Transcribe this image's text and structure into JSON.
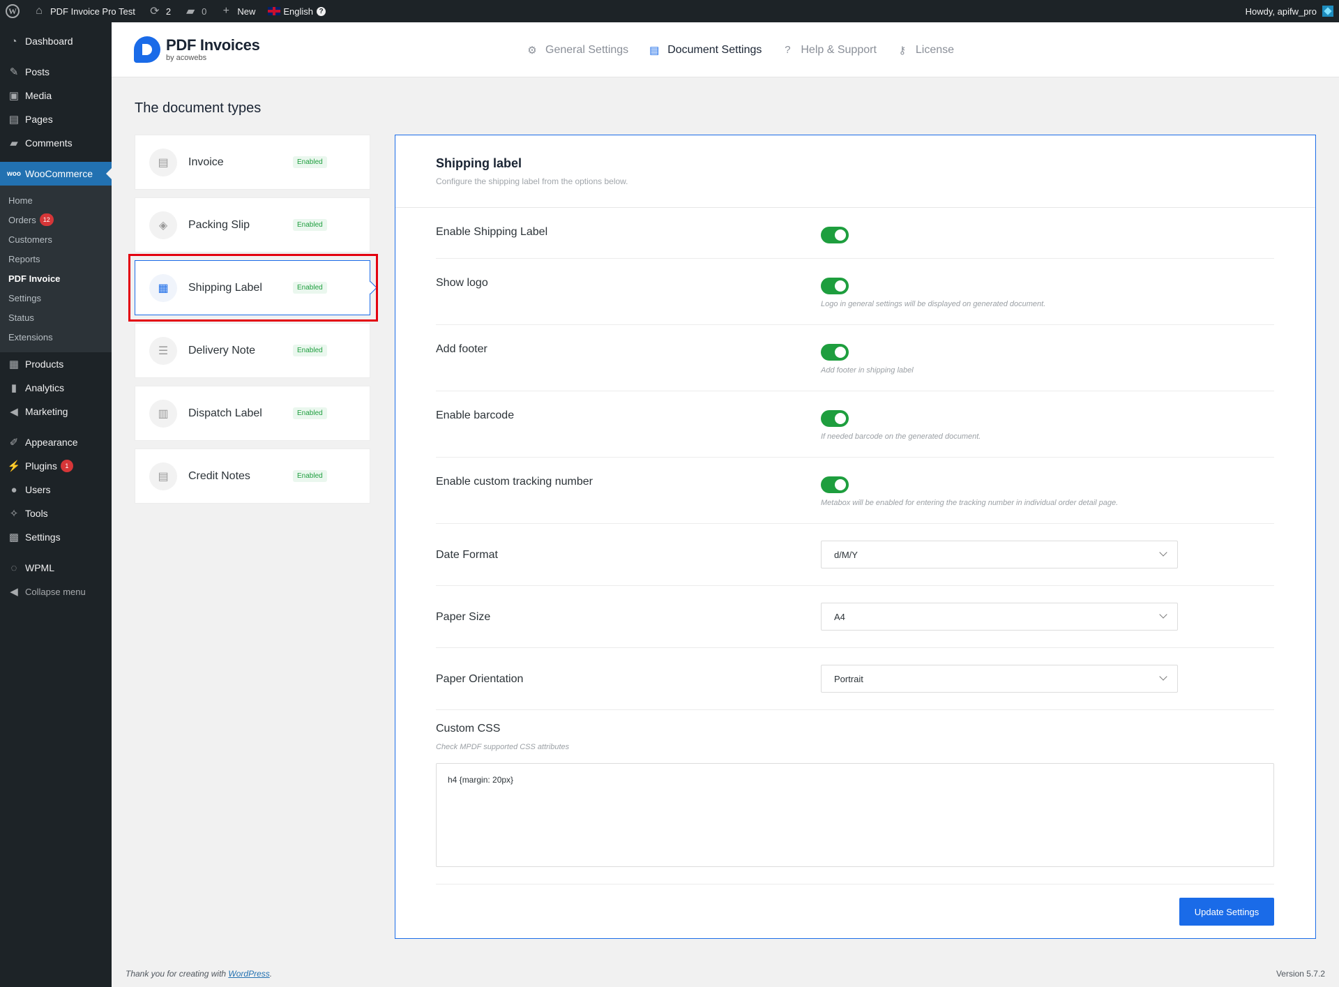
{
  "adminbar": {
    "site_name": "PDF Invoice Pro Test",
    "updates_count": "2",
    "comments_count": "0",
    "new_label": "New",
    "language": "English",
    "howdy": "Howdy, apifw_pro",
    "icons": [
      "wordpress-logo-icon",
      "home-icon",
      "updates-icon",
      "comment-icon",
      "plus-icon",
      "flag-icon",
      "help-icon"
    ]
  },
  "sidebar": {
    "top_items": [
      {
        "label": "Dashboard",
        "icon": "dashboard-icon"
      },
      {
        "label": "Posts",
        "icon": "pin-icon"
      },
      {
        "label": "Media",
        "icon": "media-icon"
      },
      {
        "label": "Pages",
        "icon": "pages-icon"
      },
      {
        "label": "Comments",
        "icon": "comments-icon"
      }
    ],
    "woocommerce": {
      "label": "WooCommerce",
      "icon": "woo-icon"
    },
    "woo_submenu": [
      {
        "label": "Home"
      },
      {
        "label": "Orders",
        "badge": "12"
      },
      {
        "label": "Customers"
      },
      {
        "label": "Reports"
      },
      {
        "label": "PDF Invoice",
        "current": true
      },
      {
        "label": "Settings"
      },
      {
        "label": "Status"
      },
      {
        "label": "Extensions"
      }
    ],
    "bottom_items": [
      {
        "label": "Products",
        "icon": "products-icon"
      },
      {
        "label": "Analytics",
        "icon": "analytics-icon"
      },
      {
        "label": "Marketing",
        "icon": "megaphone-icon"
      },
      {
        "label": "Appearance",
        "icon": "brush-icon"
      },
      {
        "label": "Plugins",
        "icon": "plugins-icon",
        "badge": "1"
      },
      {
        "label": "Users",
        "icon": "users-icon"
      },
      {
        "label": "Tools",
        "icon": "wrench-icon"
      },
      {
        "label": "Settings",
        "icon": "settings-icon"
      },
      {
        "label": "WPML",
        "icon": "wpml-icon"
      },
      {
        "label": "Collapse menu",
        "icon": "collapse-icon"
      }
    ]
  },
  "plugin": {
    "logo_title": "PDF Invoices",
    "logo_subtitle": "by acowebs",
    "tabs": [
      {
        "label": "General Settings",
        "icon": "gear-icon",
        "active": false
      },
      {
        "label": "Document Settings",
        "icon": "document-icon",
        "active": true
      },
      {
        "label": "Help & Support",
        "icon": "help-circle-icon",
        "active": false
      },
      {
        "label": "License",
        "icon": "key-icon",
        "active": false
      }
    ],
    "accent_color": "#1a6be8",
    "toggle_color": "#1e9e3e"
  },
  "page_title": "The document types",
  "documents": [
    {
      "name": "Invoice",
      "status": "Enabled",
      "icon": "invoice-icon"
    },
    {
      "name": "Packing Slip",
      "status": "Enabled",
      "icon": "box-icon"
    },
    {
      "name": "Shipping Label",
      "status": "Enabled",
      "icon": "label-icon",
      "selected": true
    },
    {
      "name": "Delivery Note",
      "status": "Enabled",
      "icon": "delivery-icon"
    },
    {
      "name": "Dispatch Label",
      "status": "Enabled",
      "icon": "barcode-icon"
    },
    {
      "name": "Credit Notes",
      "status": "Enabled",
      "icon": "note-icon"
    }
  ],
  "panel": {
    "title": "Shipping label",
    "subtitle": "Configure the shipping label from the options below.",
    "toggles": [
      {
        "label": "Enable Shipping Label",
        "value": true,
        "description": ""
      },
      {
        "label": "Show logo",
        "value": true,
        "description": "Logo in general settings will be displayed on generated document."
      },
      {
        "label": "Add footer",
        "value": true,
        "description": "Add footer in shipping label"
      },
      {
        "label": "Enable barcode",
        "value": true,
        "description": "If needed barcode on the generated document."
      },
      {
        "label": "Enable custom tracking number",
        "value": true,
        "description": "Metabox will be enabled for entering the tracking number in individual order detail page."
      }
    ],
    "selects": [
      {
        "label": "Date Format",
        "value": "d/M/Y"
      },
      {
        "label": "Paper Size",
        "value": "A4"
      },
      {
        "label": "Paper Orientation",
        "value": "Portrait"
      }
    ],
    "custom_css": {
      "label": "Custom CSS",
      "description": "Check MPDF supported CSS attributes",
      "value": "h4 {margin: 20px}"
    },
    "update_button": "Update Settings"
  },
  "footer": {
    "thanks_prefix": "Thank you for creating with ",
    "thanks_link": "WordPress",
    "thanks_suffix": ".",
    "version": "Version 5.7.2"
  }
}
